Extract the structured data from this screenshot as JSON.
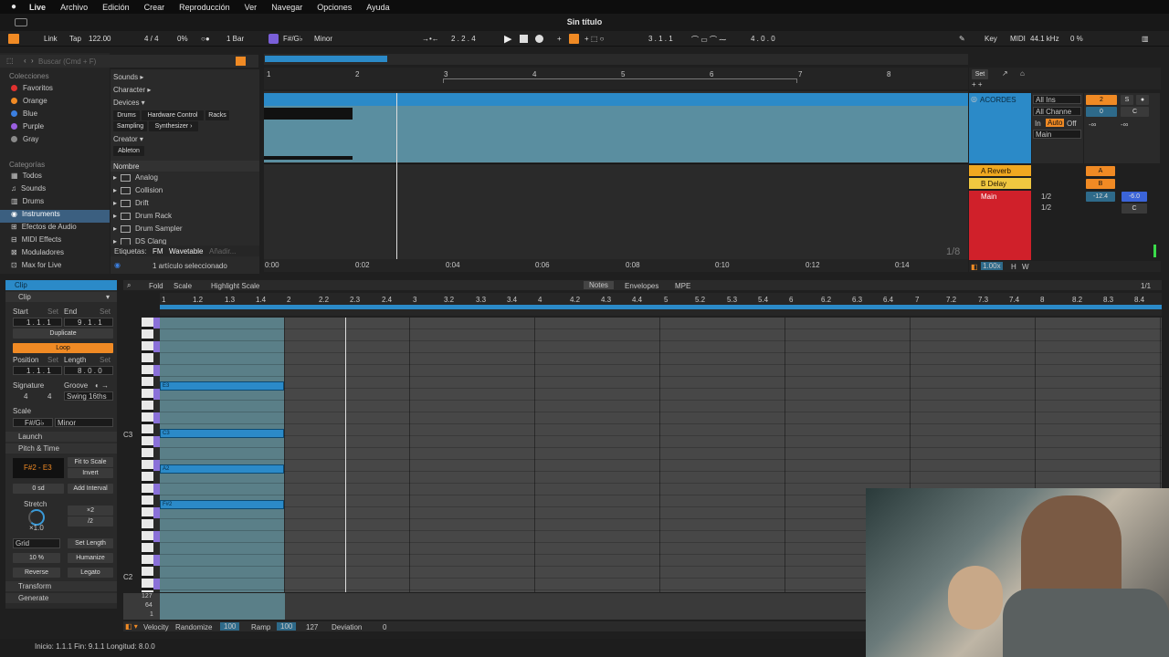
{
  "menubar": {
    "apple": "",
    "app": "Live",
    "items": [
      "Archivo",
      "Edición",
      "Crear",
      "Reproducción",
      "Ver",
      "Navegar",
      "Opciones",
      "Ayuda"
    ]
  },
  "window": {
    "title": "Sin título"
  },
  "transport": {
    "link": "Link",
    "tap": "Tap",
    "tempo": "122.00",
    "signature": "4 / 4",
    "swing": "0%",
    "quantize": "1 Bar",
    "key": "F#/G♭",
    "scale": "Minor",
    "position": "2 .  2 .  4",
    "loop_start": "3 .  1 .  1",
    "loop_length": "4 .  0 .  0",
    "key_label": "Key",
    "midi_label": "MIDI",
    "sample_rate": "44.1 kHz",
    "cpu": "0 %"
  },
  "browser": {
    "search_placeholder": "Buscar (Cmd + F)",
    "collections_label": "Colecciones",
    "collections": [
      {
        "name": "Favoritos",
        "color": "#e0312f"
      },
      {
        "name": "Orange",
        "color": "#f08a24"
      },
      {
        "name": "Blue",
        "color": "#3b7fe0"
      },
      {
        "name": "Purple",
        "color": "#9a5fe0"
      },
      {
        "name": "Gray",
        "color": "#8a8a8a"
      }
    ],
    "categories_label": "Categorías",
    "categories": [
      "Todos",
      "Sounds",
      "Drums",
      "Instruments",
      "Efectos de Audio",
      "MIDI Effects",
      "Moduladores",
      "Max for Live"
    ],
    "selected_category": "Instruments",
    "filters": {
      "sounds": "Sounds ▸",
      "character": "Character ▸",
      "devices": "Devices ▾",
      "tags": [
        "Drums",
        "Hardware Control",
        "Racks",
        "Sampling",
        "Synthesizer ›"
      ],
      "creator": "Creator ▾",
      "creator_tag": "Ableton"
    },
    "list_header": "Nombre",
    "items": [
      "Analog",
      "Collision",
      "Drift",
      "Drum Rack",
      "Drum Sampler",
      "DS Clang"
    ],
    "labels_title": "Etiquetas:",
    "labels": [
      "FM",
      "Wavetable",
      "Añadir..."
    ],
    "status": "1 artículo seleccionado"
  },
  "arrangement": {
    "bar_numbers": [
      "1",
      "2",
      "3",
      "4",
      "5",
      "6",
      "7",
      "8"
    ],
    "time_labels": [
      "0:00",
      "0:02",
      "0:04",
      "0:06",
      "0:08",
      "0:10",
      "0:12",
      "0:14"
    ],
    "zoom": "1/8",
    "set_label": "Set",
    "tracks": [
      {
        "name": "ACORDES",
        "color": "#2b8ac8",
        "input": "All Ins",
        "channel": "All Channe",
        "monitor": [
          "In",
          "Auto",
          "Off"
        ],
        "output": "Main",
        "number": "2",
        "volume": "0",
        "pan": "C"
      },
      {
        "name": "A Reverb",
        "color": "#f0a820",
        "send": "A"
      },
      {
        "name": "B Delay",
        "color": "#f0c840",
        "send": "B"
      },
      {
        "name": "Main",
        "color": "#d0202a",
        "out_a": "1/2",
        "out_b": "1/2",
        "volume": "-12.4",
        "pan_val": "-6.0",
        "pan": "C"
      }
    ],
    "scale_value": "1.00x",
    "h": "H",
    "w": "W"
  },
  "clip": {
    "title": "Clip",
    "section": "Clip",
    "start_label": "Start",
    "end_label": "End",
    "set": "Set",
    "start": "1 .  1 .  1",
    "end": "9 .  1 .  1",
    "duplicate": "Duplicate",
    "loop": "Loop",
    "position_label": "Position",
    "length_label": "Length",
    "position": "1 .  1 .  1",
    "length": "8 .  0 .  0",
    "signature_label": "Signature",
    "groove_label": "Groove",
    "sig_num": "4",
    "sig_den": "4",
    "groove": "Swing 16ths",
    "scale_label": "Scale",
    "scale_key": "F#/G♭",
    "scale_mode": "Minor",
    "launch": "Launch",
    "pitch_time": "Pitch & Time",
    "range": "F#2 - E3",
    "fit_to_scale": "Fit to Scale",
    "invert": "Invert",
    "semitones": "0 sd",
    "add_interval": "Add Interval",
    "stretch": "Stretch",
    "x2": "×2",
    "div2": "/2",
    "stretch_val": "×1.0",
    "grid": "Grid",
    "set_length": "Set Length",
    "humanize_amt": "10 %",
    "humanize": "Humanize",
    "reverse": "Reverse",
    "legato": "Legato",
    "transform": "Transform",
    "generate": "Generate"
  },
  "editor": {
    "fold": "Fold",
    "scale": "Scale",
    "highlight": "Highlight Scale",
    "tabs": [
      "Notes",
      "Envelopes",
      "MPE"
    ],
    "grid_display": "1/1",
    "ruler": [
      "1",
      "1.2",
      "1.3",
      "1.4",
      "2",
      "2.2",
      "2.3",
      "2.4",
      "3",
      "3.2",
      "3.3",
      "3.4",
      "4",
      "4.2",
      "4.3",
      "4.4",
      "5",
      "5.2",
      "5.3",
      "5.4",
      "6",
      "6.2",
      "6.3",
      "6.4",
      "7",
      "7.2",
      "7.3",
      "7.4",
      "8",
      "8.2",
      "8.3",
      "8.4"
    ],
    "key_labels": {
      "c3": "C3",
      "c2": "C2"
    },
    "notes": [
      {
        "pitch": "E3",
        "label": "E3"
      },
      {
        "pitch": "C3",
        "label": "C3"
      },
      {
        "pitch": "A2",
        "label": "A2"
      },
      {
        "pitch": "F#2",
        "label": "F#2"
      }
    ],
    "vel_scale": [
      "127",
      "64",
      "1"
    ],
    "velocity": "Velocity",
    "randomize": "Randomize",
    "rand_val": "100",
    "ramp": "Ramp",
    "ramp_val": "100",
    "ramp_end": "127",
    "deviation": "Deviation",
    "dev_val": "0"
  },
  "status_bar": "Inicio: 1.1.1  Fin: 9.1.1  Longitud: 8.0.0"
}
